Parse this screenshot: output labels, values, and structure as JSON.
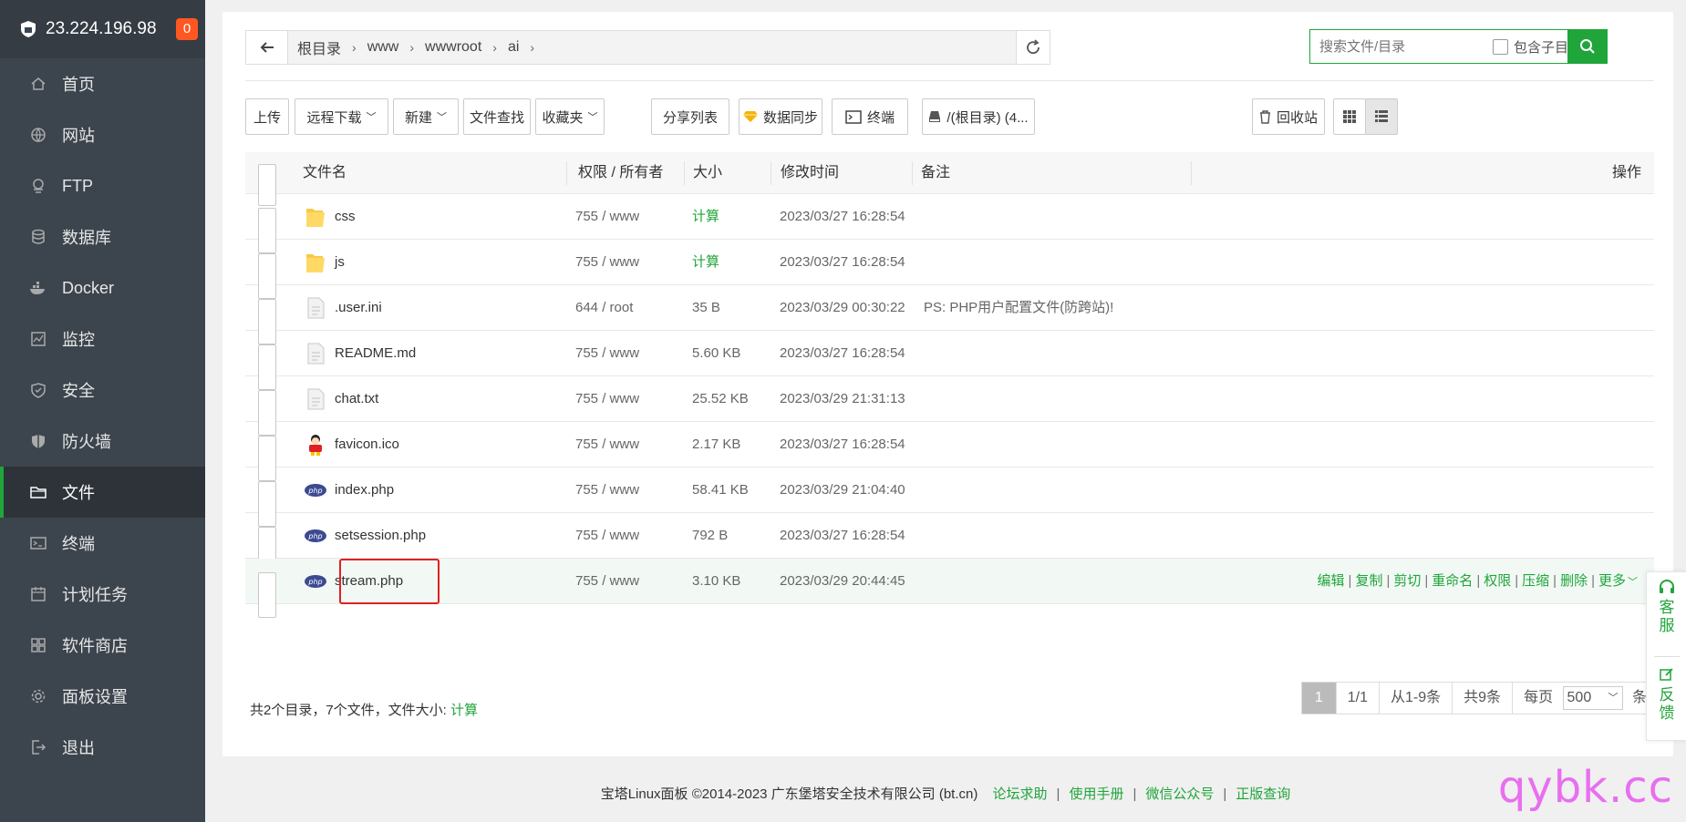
{
  "server": {
    "ip": "23.224.196.98",
    "badge": "0"
  },
  "sidebar": {
    "items": [
      {
        "label": "首页",
        "icon": "home-icon"
      },
      {
        "label": "网站",
        "icon": "globe-icon"
      },
      {
        "label": "FTP",
        "icon": "ftp-icon"
      },
      {
        "label": "数据库",
        "icon": "database-icon"
      },
      {
        "label": "Docker",
        "icon": "docker-icon"
      },
      {
        "label": "监控",
        "icon": "monitor-icon"
      },
      {
        "label": "安全",
        "icon": "shield-icon"
      },
      {
        "label": "防火墙",
        "icon": "firewall-icon"
      },
      {
        "label": "文件",
        "icon": "folder-icon",
        "active": true
      },
      {
        "label": "终端",
        "icon": "terminal-icon"
      },
      {
        "label": "计划任务",
        "icon": "calendar-icon"
      },
      {
        "label": "软件商店",
        "icon": "apps-icon"
      },
      {
        "label": "面板设置",
        "icon": "gear-icon"
      },
      {
        "label": "退出",
        "icon": "logout-icon"
      }
    ]
  },
  "breadcrumb": [
    "根目录",
    "www",
    "wwwroot",
    "ai"
  ],
  "search": {
    "placeholder": "搜索文件/目录",
    "subdir_label": "包含子目录"
  },
  "toolbar": {
    "upload": "上传",
    "remote_download": "远程下载",
    "new": "新建",
    "file_search": "文件查找",
    "favorites": "收藏夹",
    "share_list": "分享列表",
    "data_sync": "数据同步",
    "terminal": "终端",
    "disk": "/(根目录) (4...",
    "recycle": "回收站"
  },
  "table": {
    "headers": {
      "name": "文件名",
      "perm": "权限 / 所有者",
      "size": "大小",
      "mtime": "修改时间",
      "note": "备注",
      "ops": "操作"
    },
    "rows": [
      {
        "name": "css",
        "type": "folder",
        "perm": "755 / www",
        "size": "计算",
        "mtime": "2023/03/27 16:28:54",
        "note": ""
      },
      {
        "name": "js",
        "type": "folder",
        "perm": "755 / www",
        "size": "计算",
        "mtime": "2023/03/27 16:28:54",
        "note": ""
      },
      {
        "name": ".user.ini",
        "type": "file",
        "perm": "644 / root",
        "size": "35 B",
        "mtime": "2023/03/29 00:30:22",
        "note": "PS: PHP用户配置文件(防跨站)!"
      },
      {
        "name": "README.md",
        "type": "file",
        "perm": "755 / www",
        "size": "5.60 KB",
        "mtime": "2023/03/27 16:28:54",
        "note": ""
      },
      {
        "name": "chat.txt",
        "type": "file",
        "perm": "755 / www",
        "size": "25.52 KB",
        "mtime": "2023/03/29 21:31:13",
        "note": ""
      },
      {
        "name": "favicon.ico",
        "type": "image",
        "perm": "755 / www",
        "size": "2.17 KB",
        "mtime": "2023/03/27 16:28:54",
        "note": ""
      },
      {
        "name": "index.php",
        "type": "php",
        "perm": "755 / www",
        "size": "58.41 KB",
        "mtime": "2023/03/29 21:04:40",
        "note": ""
      },
      {
        "name": "setsession.php",
        "type": "php",
        "perm": "755 / www",
        "size": "792 B",
        "mtime": "2023/03/27 16:28:54",
        "note": ""
      },
      {
        "name": "stream.php",
        "type": "php",
        "perm": "755 / www",
        "size": "3.10 KB",
        "mtime": "2023/03/29 20:44:45",
        "note": "",
        "selected": true
      }
    ],
    "row_ops": [
      "编辑",
      "复制",
      "剪切",
      "重命名",
      "权限",
      "压缩",
      "删除",
      "更多"
    ]
  },
  "summary": {
    "text": "共2个目录，7个文件，文件大小:",
    "calc": "计算"
  },
  "pager": {
    "current": "1",
    "pages": "1/1",
    "range": "从1-9条",
    "total": "共9条",
    "per_page_label": "每页",
    "per_page": "500",
    "unit": "条"
  },
  "footer": {
    "copyright": "宝塔Linux面板 ©2014-2023 广东堡塔安全技术有限公司 (bt.cn)",
    "links": [
      "论坛求助",
      "使用手册",
      "微信公众号",
      "正版查询"
    ]
  },
  "float": {
    "service": [
      "客",
      "服"
    ],
    "feedback": [
      "反",
      "馈"
    ]
  },
  "watermark": "qybk.cc",
  "colors": {
    "accent": "#20a53a",
    "sidebar": "#3c444d",
    "badge": "#ff5722",
    "highlight": "#e02020"
  }
}
